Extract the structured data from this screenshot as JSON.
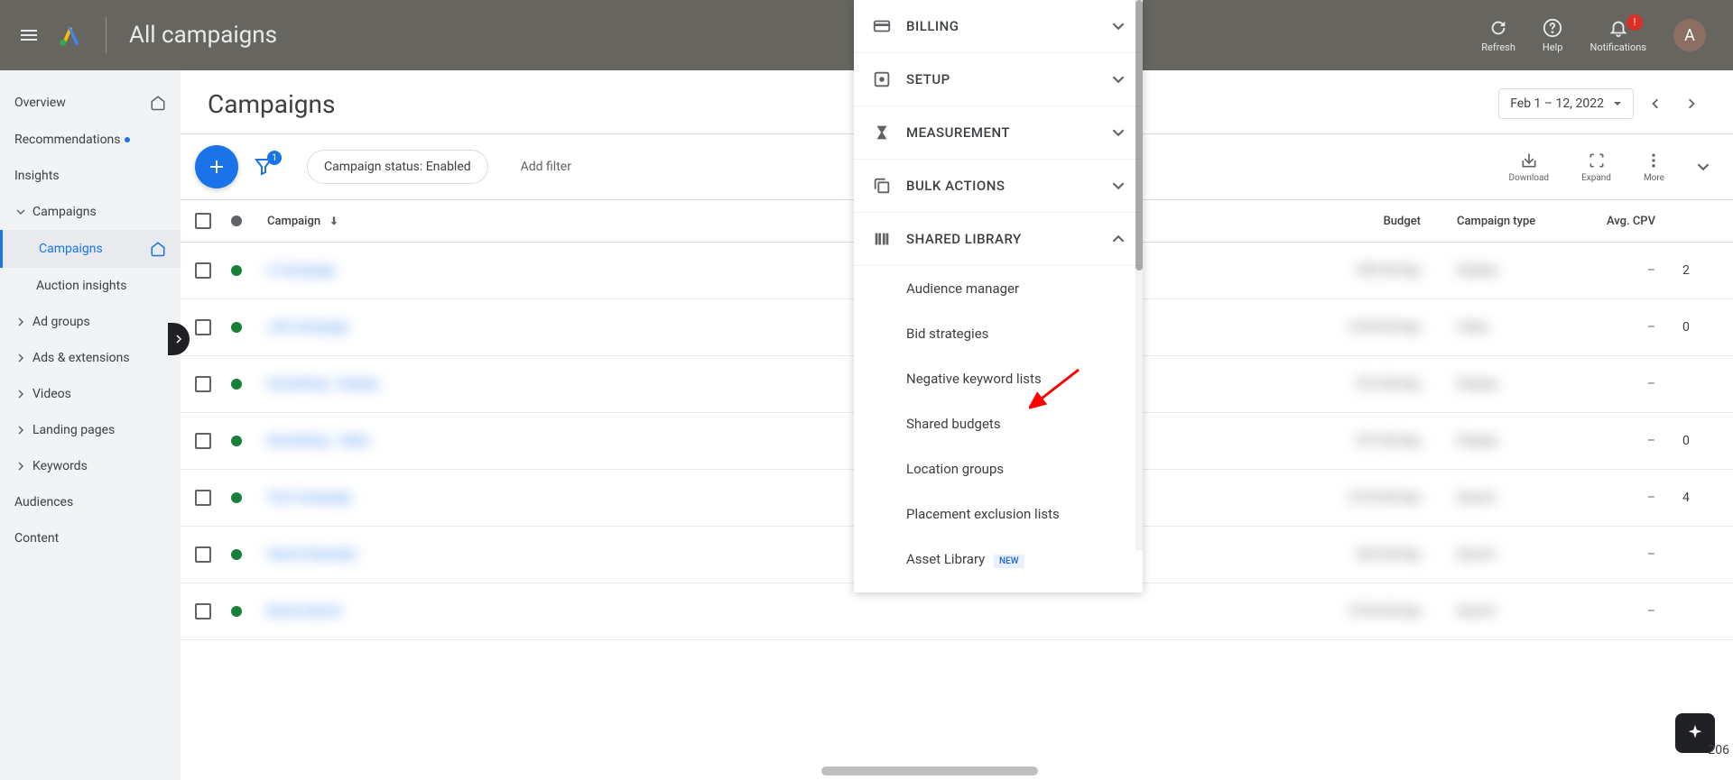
{
  "header": {
    "title": "All campaigns",
    "refresh": "Refresh",
    "help": "Help",
    "notifications": "Notifications",
    "avatar_letter": "A"
  },
  "sidebar": {
    "overview": "Overview",
    "recommendations": "Recommendations",
    "insights": "Insights",
    "campaigns": "Campaigns",
    "campaigns_sub": "Campaigns",
    "auction_insights": "Auction insights",
    "ad_groups": "Ad groups",
    "ads_extensions": "Ads & extensions",
    "videos": "Videos",
    "landing_pages": "Landing pages",
    "keywords": "Keywords",
    "audiences": "Audiences",
    "content": "Content"
  },
  "page": {
    "title": "Campaigns",
    "date_range": "Feb 1 – 12, 2022"
  },
  "toolbar": {
    "filter_count": "1",
    "status_chip": "Campaign status: Enabled",
    "add_filter": "Add filter",
    "download": "Download",
    "expand": "Expand",
    "more": "More"
  },
  "table": {
    "cols": {
      "campaign": "Campaign",
      "budget": "Budget",
      "campaign_type": "Campaign type",
      "avg_cpv": "Avg. CPV"
    },
    "rows": [
      {
        "name": "A Campaign",
        "budget": "$50.00/day",
        "ctype": "Display",
        "cpv": "–",
        "last": "2"
      },
      {
        "name": "Job Campaign",
        "budget": "$100.00/day",
        "ctype": "Video",
        "cpv": "–",
        "last": "0"
      },
      {
        "name": "Something - Display",
        "budget": "$10.00/day",
        "ctype": "Display",
        "cpv": "–",
        "last": ""
      },
      {
        "name": "Something - Video",
        "budget": "$75.00/day",
        "ctype": "Display",
        "cpv": "–",
        "last": "0"
      },
      {
        "name": "Test Campaign",
        "budget": "$120.00/day",
        "ctype": "Search",
        "cpv": "–",
        "last": "4"
      },
      {
        "name": "Search Branded",
        "budget": "$20.00/day",
        "ctype": "Search",
        "cpv": "–",
        "last": ""
      },
      {
        "name": "Brand Search",
        "budget": "$100.00/day",
        "ctype": "Search",
        "cpv": "–",
        "last": ""
      }
    ]
  },
  "tools": {
    "billing": "BILLING",
    "setup": "SETUP",
    "measurement": "MEASUREMENT",
    "bulk_actions": "BULK ACTIONS",
    "shared_library": "SHARED LIBRARY",
    "items": {
      "audience_manager": "Audience manager",
      "bid_strategies": "Bid strategies",
      "negative_keyword_lists": "Negative keyword lists",
      "shared_budgets": "Shared budgets",
      "location_groups": "Location groups",
      "placement_exclusion_lists": "Placement exclusion lists",
      "asset_library": "Asset Library",
      "new_badge": "NEW"
    }
  },
  "partial": "206"
}
